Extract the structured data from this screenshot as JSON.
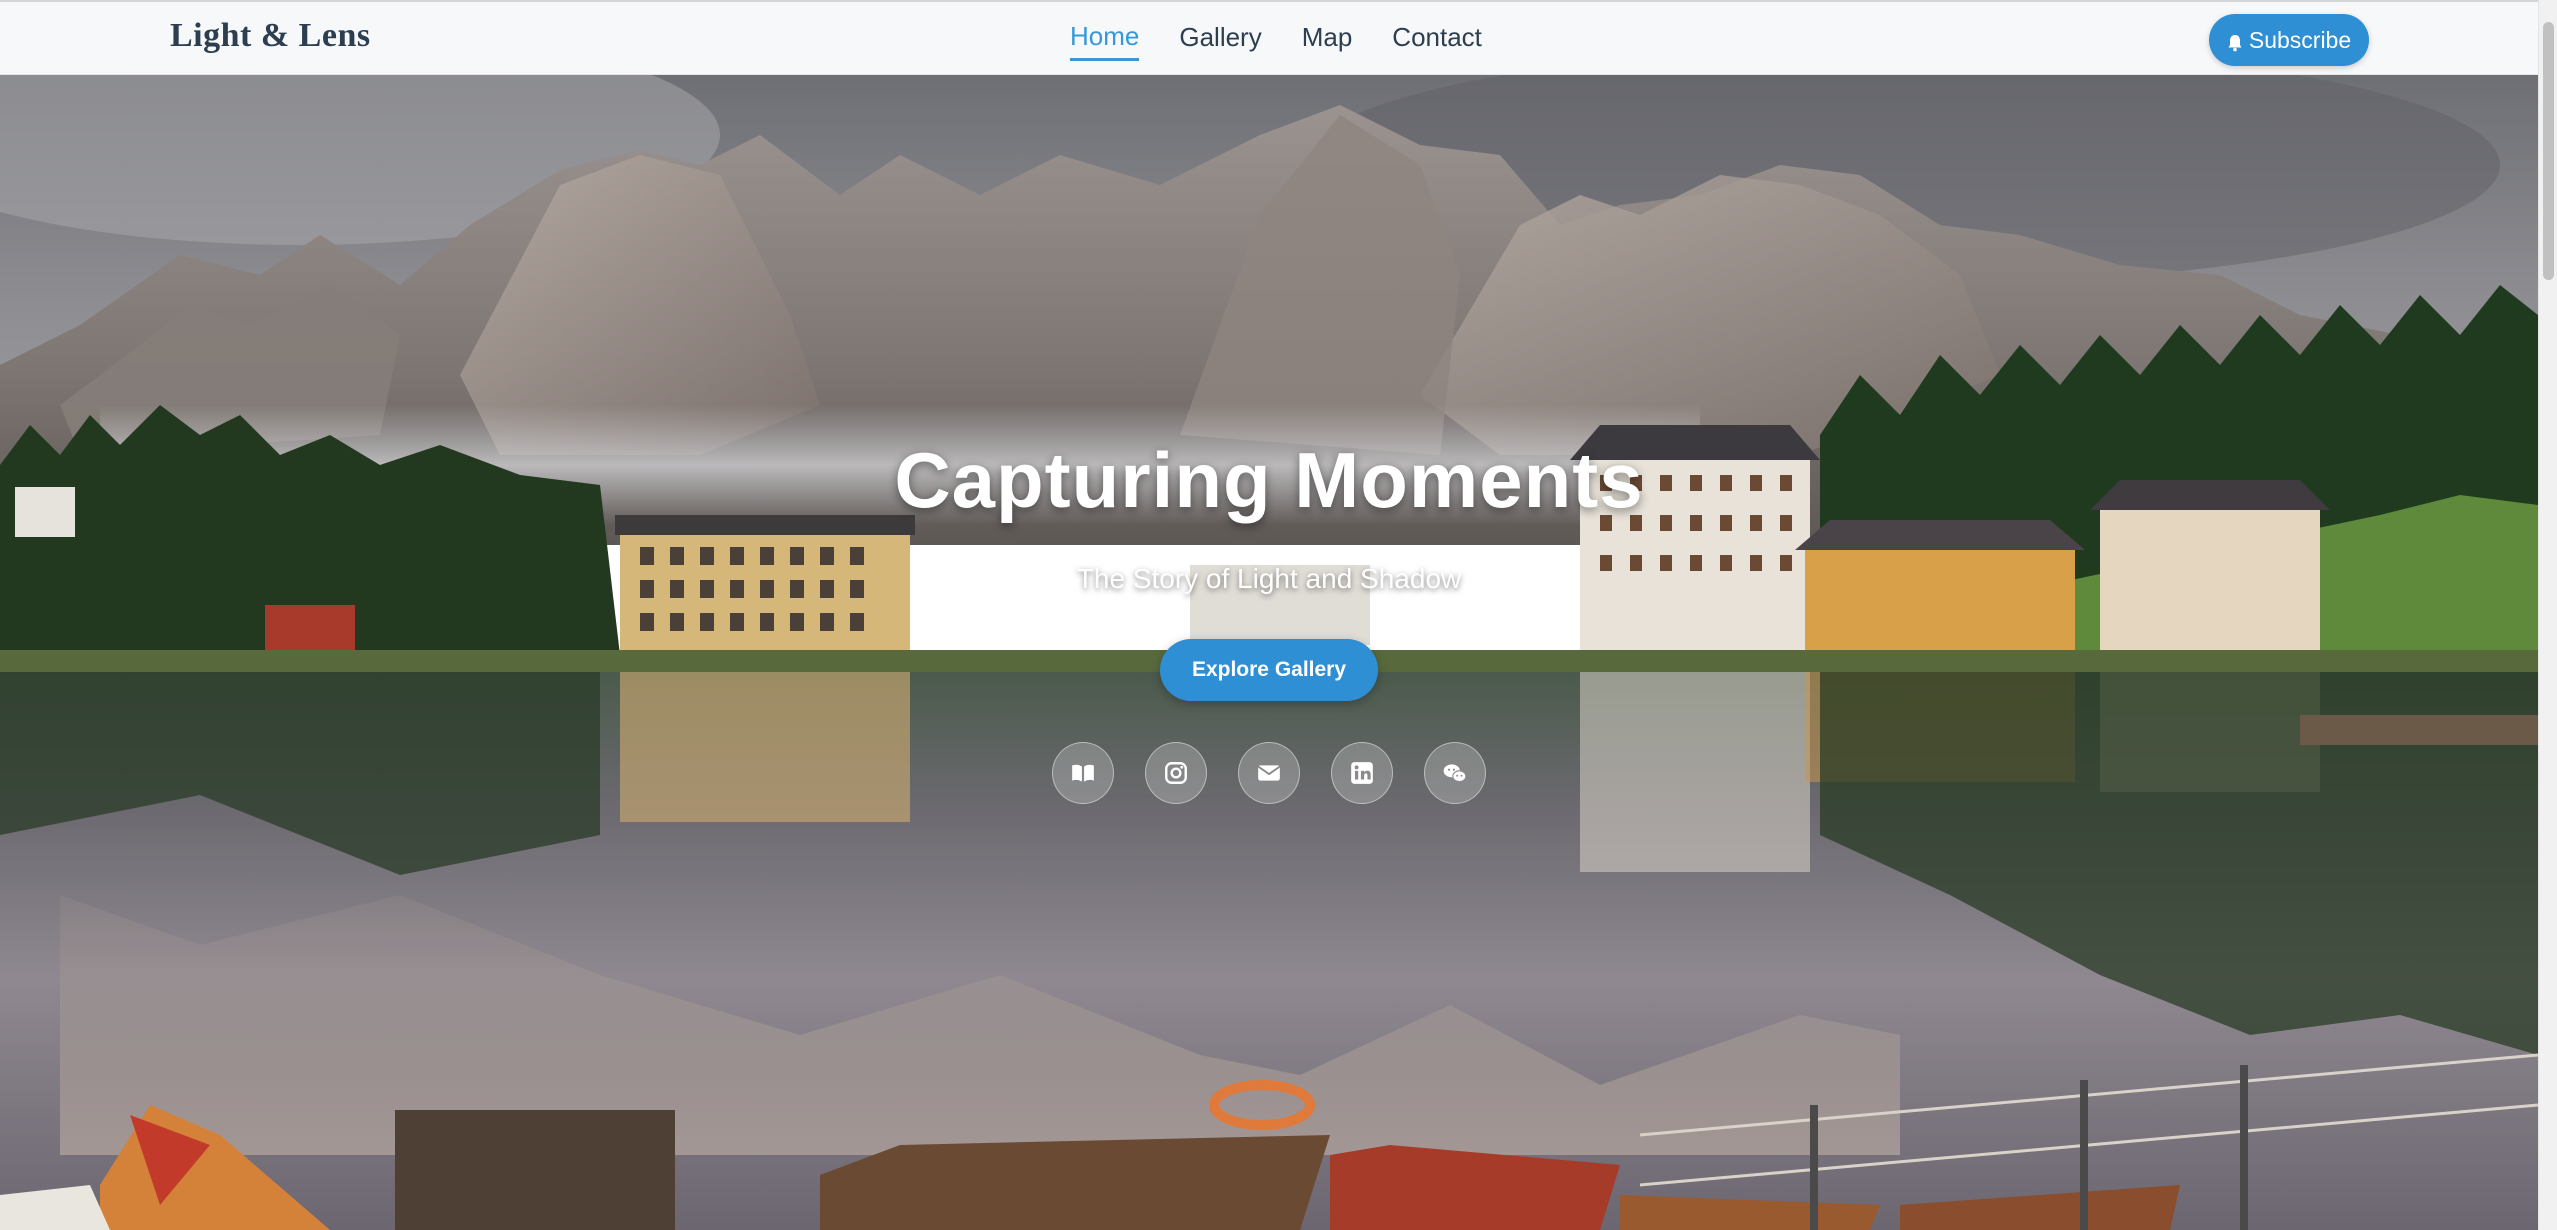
{
  "brand": {
    "name": "Light & Lens"
  },
  "nav": {
    "links": [
      {
        "label": "Home",
        "active": true
      },
      {
        "label": "Gallery",
        "active": false
      },
      {
        "label": "Map",
        "active": false
      },
      {
        "label": "Contact",
        "active": false
      }
    ],
    "subscribe_label": "Subscribe",
    "subscribe_icon": "bell-icon"
  },
  "hero": {
    "title": "Capturing Moments",
    "subtitle": "The Story of Light and Shadow",
    "cta_label": "Explore Gallery",
    "background": "mountain-lake-village-photo",
    "social_icons": [
      "book-icon",
      "instagram-icon",
      "envelope-icon",
      "linkedin-icon",
      "wechat-icon"
    ]
  },
  "colors": {
    "accent": "#3498db",
    "brand_text": "#2c3e50",
    "nav_bg": "#f7f8f9"
  }
}
